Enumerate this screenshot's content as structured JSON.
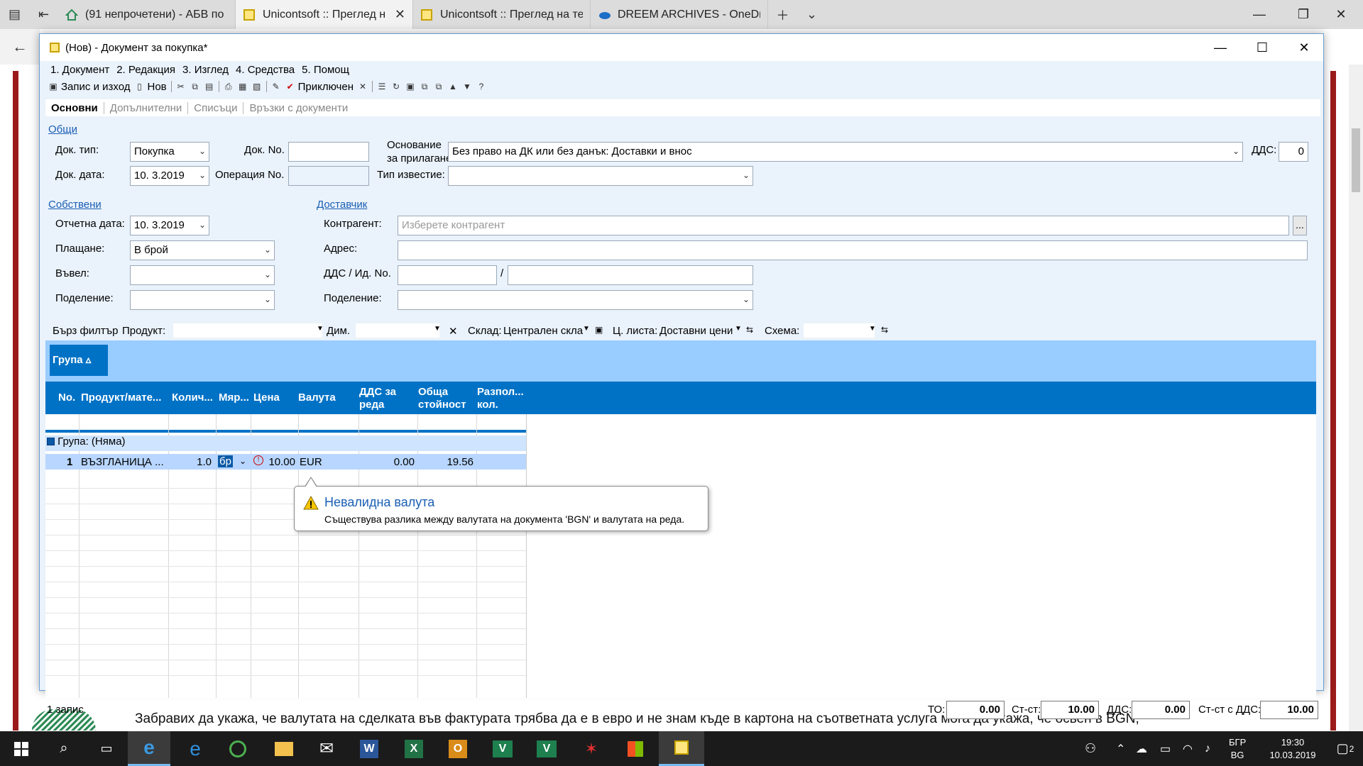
{
  "browser": {
    "tabs": [
      {
        "title": "(91 непрочетени) - АБВ по",
        "icon": "home-icon"
      },
      {
        "title": "Unicontsoft :: Преглед н",
        "icon": "doc-icon",
        "active": true
      },
      {
        "title": "Unicontsoft :: Преглед на те",
        "icon": "doc-icon"
      },
      {
        "title": "DREEM ARCHIVES - OneDri",
        "icon": "cloud-icon"
      }
    ]
  },
  "page": {
    "body_text": "Забравих да укажа, че валутата на сделката във фактурата трябва да е в евро и не знам къде в картона на съответната услуга мога да укажа, че освен в BGN,"
  },
  "dialog": {
    "title": "(Нов) - Документ за покупка*",
    "menu": [
      "1. Документ",
      "2. Редакция",
      "3. Изглед",
      "4. Средства",
      "5. Помощ"
    ],
    "toolbar": {
      "save_exit": "Запис и изход",
      "new": "Нов",
      "completed": "Приключен"
    },
    "tabs": [
      "Основни",
      "Допълнителни",
      "Списъци",
      "Връзки с документи"
    ],
    "general": {
      "section": "Общи",
      "doc_type_label": "Док. тип:",
      "doc_type": "Покупка",
      "doc_no_label": "Док. No.",
      "doc_no": "",
      "basis_label_1": "Основание",
      "basis_label_2": "за прилагане:",
      "basis": "Без право на ДК или без данък: Доставки и внос",
      "vat_label": "ДДС:",
      "vat": "0",
      "doc_date_label": "Док. дата:",
      "doc_date": "10. 3.2019",
      "operation_no_label": "Операция No.",
      "operation_no": "",
      "notice_type_label": "Тип известие:",
      "notice_type": ""
    },
    "own": {
      "section": "Собствени",
      "report_date_label": "Отчетна дата:",
      "report_date": "10. 3.2019",
      "payment_label": "Плащане:",
      "payment": "В брой",
      "entered_by_label": "Въвел:",
      "entered_by": "",
      "division_label": "Поделение:",
      "division": ""
    },
    "supplier": {
      "section": "Доставчик",
      "partner_label": "Контрагент:",
      "partner_placeholder": "Изберете контрагент",
      "address_label": "Адрес:",
      "address": "",
      "vat_id_label": "ДДС / Ид. No.",
      "vat_id": "",
      "id_no": "",
      "division_label": "Поделение:",
      "division": ""
    },
    "filter": {
      "quick_filter": "Бърз филтър",
      "product_label": "Продукт:",
      "dim_label": "Дим.",
      "warehouse_label": "Склад:",
      "warehouse": "Централен скла",
      "price_list_label": "Ц. листа:",
      "price_list": "Доставни цени",
      "scheme_label": "Схема:"
    },
    "grid": {
      "group_chip": "Група ▵",
      "columns": [
        "No.",
        "Продукт/мате...",
        "Колич...",
        "Мяр...",
        "Цена",
        "Валута",
        "ДДС за реда",
        "Обща стойност с",
        "Разпол... кол."
      ],
      "group_row": "Група: (Няма)",
      "rows": [
        {
          "no": "1",
          "product": "ВЪЗГЛАНИЦА ...",
          "qty": "1.0",
          "unit": "бр",
          "price": "10.00",
          "currency": "EUR",
          "vat": "0.00",
          "total": "19.56",
          "available": ""
        }
      ]
    },
    "tooltip": {
      "title": "Невалидна валута",
      "body": "Съществува разлика между валутата на документа 'BGN' и валутата на реда."
    },
    "status": {
      "records": "1 запис",
      "to_label": "ТО:",
      "to": "0.00",
      "value_label": "Ст-ст:",
      "value": "10.00",
      "vat_label": "ДДС:",
      "vat": "0.00",
      "value_vat_label": "Ст-ст с ДДС:",
      "value_vat": "10.00"
    }
  },
  "taskbar": {
    "lang_top": "БГР",
    "lang_bottom": "BG",
    "time": "19:30",
    "date": "10.03.2019",
    "notifications": "2"
  },
  "colors": {
    "accent": "#0072c6",
    "group_panel": "#99ccff",
    "dialog_bg": "#eaf2fb",
    "frame_red": "#9b1b1b",
    "link": "#1a5fb4"
  }
}
